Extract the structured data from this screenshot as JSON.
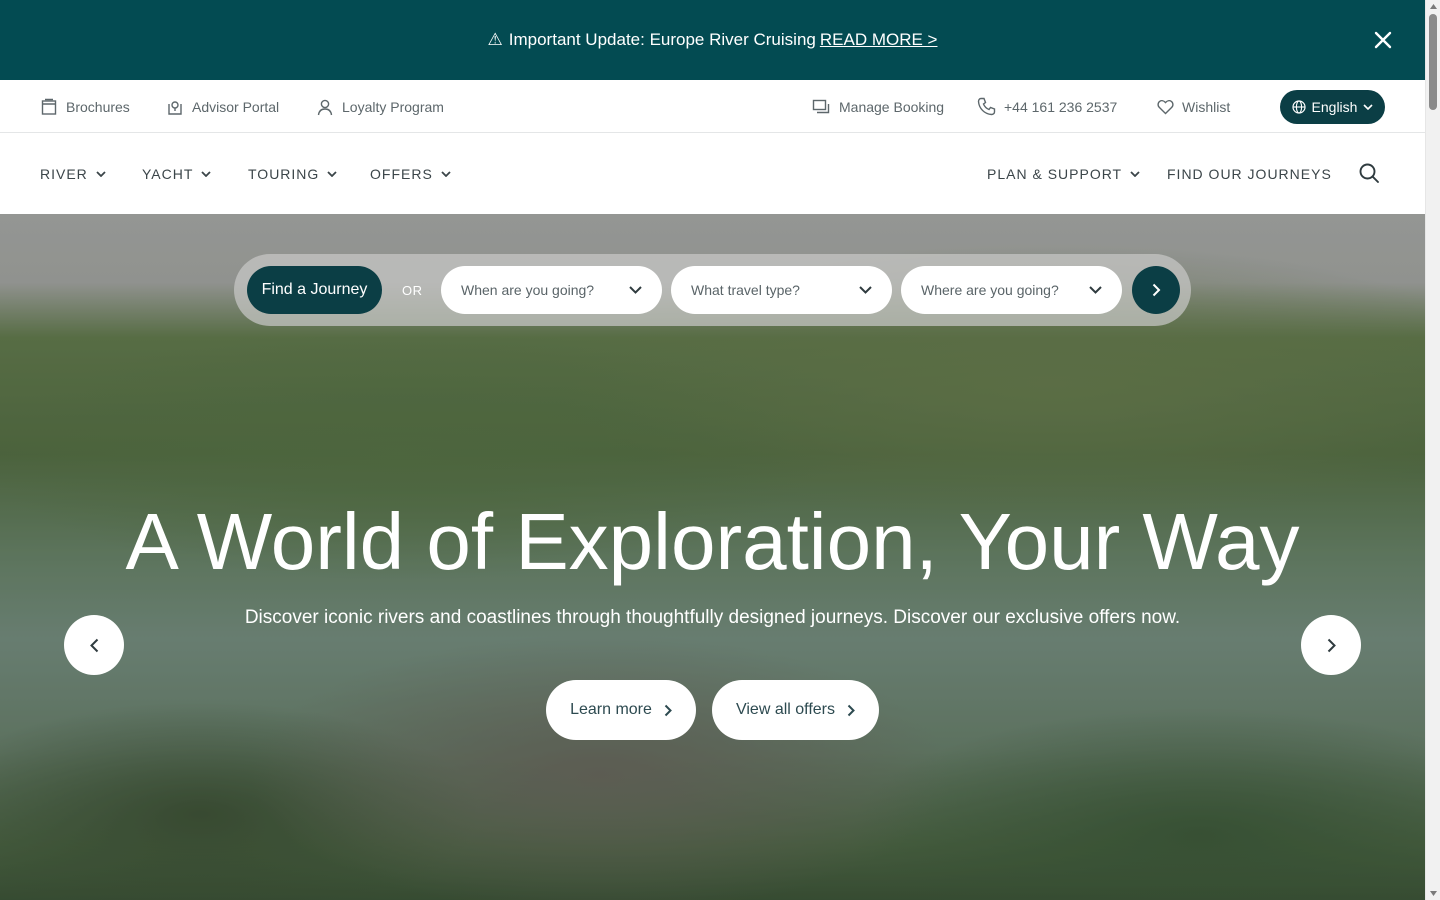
{
  "banner": {
    "warning_glyph": "⚠",
    "text": "Important Update: Europe River Cruising",
    "link_label": "READ MORE >",
    "close_icon": "close-icon"
  },
  "utility": {
    "items": [
      {
        "label": "Brochures",
        "icon": "brochure-icon"
      },
      {
        "label": "Advisor Portal",
        "icon": "advisor-portal-icon"
      },
      {
        "label": "Loyalty Program",
        "icon": "user-icon"
      },
      {
        "label": "Manage Booking",
        "icon": "chat-icon"
      },
      {
        "label": "+44 161 236 2537",
        "icon": "phone-icon"
      },
      {
        "label": "Wishlist",
        "icon": "heart-icon"
      }
    ],
    "language": "English"
  },
  "nav": {
    "left": [
      "RIVER",
      "YACHT",
      "TOURING",
      "OFFERS"
    ],
    "plan_support": "PLAN & SUPPORT",
    "find_journeys": "FIND OUR JOURNEYS"
  },
  "finder": {
    "button": "Find a Journey",
    "or": "OR",
    "when": "When are you going?",
    "type": "What travel type?",
    "where": "Where are you going?"
  },
  "hero": {
    "title": "A World of Exploration, Your Way",
    "subtitle": "Discover iconic rivers and coastlines through thoughtfully designed journeys. Discover our exclusive offers now.",
    "cta_learn": "Learn more",
    "cta_offers": "View all offers"
  },
  "colors": {
    "banner": "#034b52",
    "primary": "#0b3e45"
  }
}
